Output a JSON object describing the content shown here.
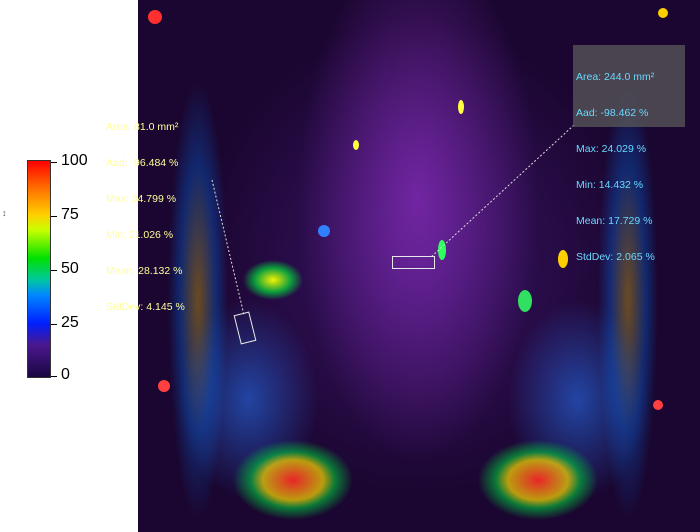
{
  "colorbar": {
    "ticks": [
      "100",
      "75",
      "50",
      "25",
      "0"
    ],
    "gradient_colors": [
      "#ff0000",
      "#ffd000",
      "#00e000",
      "#0088ff",
      "#1a0640"
    ]
  },
  "resize_glyph": "↕",
  "roi_left": {
    "area": "Area: 81.0 mm²",
    "aad": "Aad: -96.484 %",
    "max": "Max: 34.799 %",
    "min": "Min: 21.026 %",
    "mean": "Mean: 28.132 %",
    "stddev": "StdDev: 4.145 %",
    "text_color": "#ffff9a"
  },
  "roi_right": {
    "area": "Area: 244.0 mm²",
    "aad": "Aad: -98.462 %",
    "max": "Max: 24.029 %",
    "min": "Min: 14.432 %",
    "mean": "Mean: 17.729 %",
    "stddev": "StdDev: 2.065 %",
    "text_color": "#6ad8ff"
  }
}
